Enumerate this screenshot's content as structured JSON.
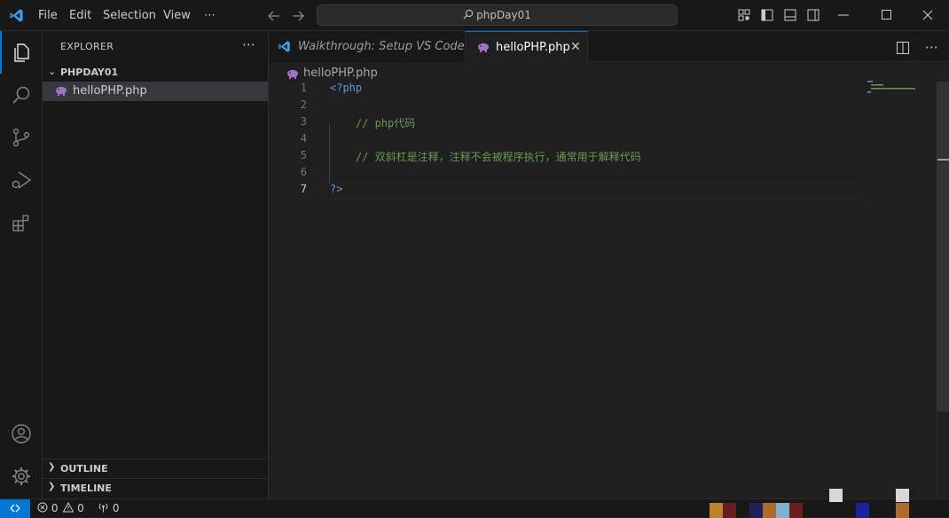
{
  "title_bar": {
    "menu": [
      "File",
      "Edit",
      "Selection",
      "View",
      "⋯"
    ],
    "search": "phpDay01",
    "back_icon": "arrow-left-icon",
    "forward_icon": "arrow-right-icon"
  },
  "sidebar": {
    "header": "EXPLORER",
    "more": "⋯",
    "folder": "PHPDAY01",
    "files": [
      {
        "name": "helloPHP.php",
        "icon": "php-elephant-icon"
      }
    ],
    "panels": [
      "OUTLINE",
      "TIMELINE"
    ]
  },
  "editor": {
    "tabs": [
      {
        "label": "Walkthrough: Setup VS Code",
        "icon": "vscode-logo-icon",
        "active": false
      },
      {
        "label": "helloPHP.php",
        "icon": "php-elephant-icon",
        "active": true,
        "close": "✕"
      }
    ],
    "breadcrumb": "helloPHP.php",
    "lines": [
      {
        "n": "1",
        "text": "<?php",
        "type": "tag"
      },
      {
        "n": "2",
        "text": "",
        "type": "plain"
      },
      {
        "n": "3",
        "text": "    // php代码",
        "type": "comment"
      },
      {
        "n": "4",
        "text": "",
        "type": "plain"
      },
      {
        "n": "5",
        "text": "    // 双斜杠是注释，注释不会被程序执行，通常用于解释代码",
        "type": "comment"
      },
      {
        "n": "6",
        "text": "",
        "type": "plain"
      },
      {
        "n": "7",
        "text": "?>",
        "type": "tag"
      }
    ],
    "current_line": "7"
  },
  "status_bar": {
    "errors": "0",
    "warnings": "0",
    "ports": "0"
  },
  "colors": {
    "accent": "#0078d4",
    "tag": "#569cd6",
    "comment": "#6a9955",
    "php_icon": "#a074c4"
  }
}
